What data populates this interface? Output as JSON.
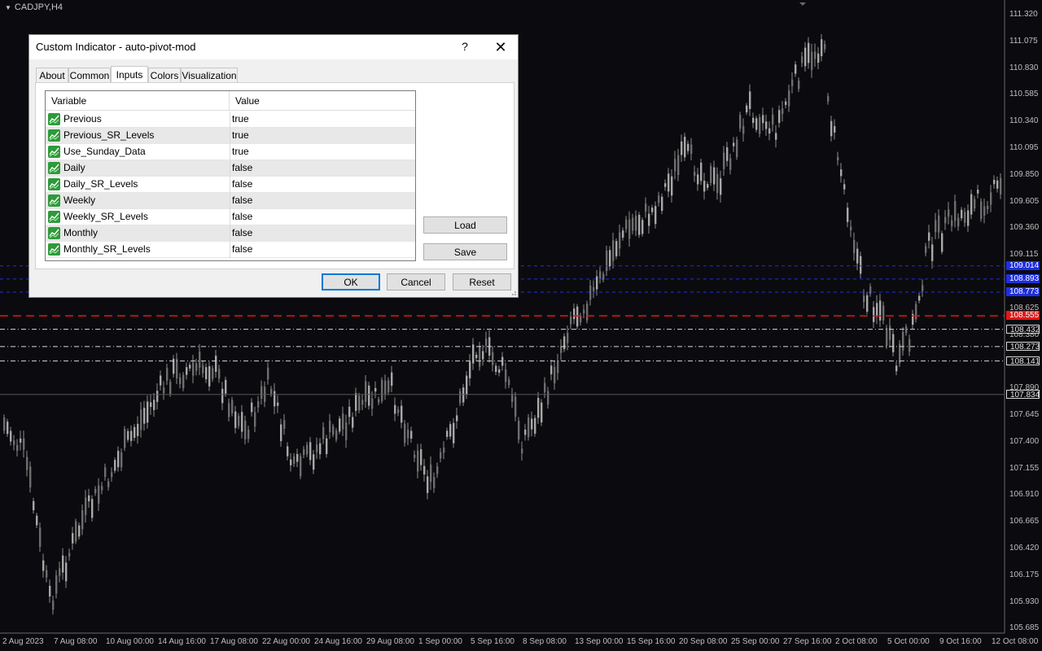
{
  "window": {
    "symbol_label": "CADJPY,H4"
  },
  "dialog": {
    "title": "Custom Indicator - auto-pivot-mod",
    "help_label": "?",
    "close_label": "✕",
    "tabs": [
      {
        "label": "About"
      },
      {
        "label": "Common"
      },
      {
        "label": "Inputs",
        "active": true
      },
      {
        "label": "Colors"
      },
      {
        "label": "Visualization"
      }
    ],
    "table": {
      "headers": {
        "variable": "Variable",
        "value": "Value"
      },
      "rows": [
        {
          "variable": "Previous",
          "value": "true"
        },
        {
          "variable": "Previous_SR_Levels",
          "value": "true"
        },
        {
          "variable": "Use_Sunday_Data",
          "value": "true"
        },
        {
          "variable": "Daily",
          "value": "false"
        },
        {
          "variable": "Daily_SR_Levels",
          "value": "false"
        },
        {
          "variable": "Weekly",
          "value": "false"
        },
        {
          "variable": "Weekly_SR_Levels",
          "value": "false"
        },
        {
          "variable": "Monthly",
          "value": "false"
        },
        {
          "variable": "Monthly_SR_Levels",
          "value": "false"
        }
      ]
    },
    "buttons": {
      "load": "Load",
      "save": "Save",
      "ok": "OK",
      "cancel": "Cancel",
      "reset": "Reset"
    }
  },
  "price_axis": {
    "labels": [
      "111.320",
      "111.075",
      "110.830",
      "110.585",
      "110.340",
      "110.095",
      "109.850",
      "109.605",
      "109.360",
      "109.115",
      "108.870",
      "108.625",
      "108.380",
      "107.890",
      "107.645",
      "107.400",
      "107.155",
      "106.910",
      "106.665",
      "106.420",
      "106.175",
      "105.930",
      "105.685"
    ],
    "badges": [
      {
        "text": "109.014",
        "color": "#1f2fe0",
        "price": 109.014
      },
      {
        "text": "108.893",
        "color": "#1f2fe0",
        "price": 108.893
      },
      {
        "text": "108.773",
        "color": "#1f2fe0",
        "price": 108.773
      },
      {
        "text": "108.555",
        "color": "#e01818",
        "price": 108.555
      },
      {
        "text": "108.432",
        "color": "#d8d8d8",
        "price": 108.432
      },
      {
        "text": "108.273",
        "color": "#d8d8d8",
        "price": 108.273
      },
      {
        "text": "108.141",
        "color": "#d8d8d8",
        "price": 108.141
      },
      {
        "text": "107.834",
        "color": "#d8d8d8",
        "price": 107.834
      }
    ]
  },
  "time_axis": {
    "labels": [
      "2 Aug 2023",
      "7 Aug 08:00",
      "10 Aug 00:00",
      "14 Aug 16:00",
      "17 Aug 08:00",
      "22 Aug 00:00",
      "24 Aug 16:00",
      "29 Aug 08:00",
      "1 Sep 00:00",
      "5 Sep 16:00",
      "8 Sep 08:00",
      "13 Sep 00:00",
      "15 Sep 16:00",
      "20 Sep 08:00",
      "25 Sep 00:00",
      "27 Sep 16:00",
      "2 Oct 08:00",
      "5 Oct 00:00",
      "9 Oct 16:00",
      "12 Oct 08:00"
    ]
  },
  "colors": {
    "background": "#0b0b0f",
    "candle": "#9a9a9a",
    "pivot_blue": "#1f2fe0",
    "pivot_red": "#e01818",
    "pivot_white": "#d8d8d8"
  }
}
